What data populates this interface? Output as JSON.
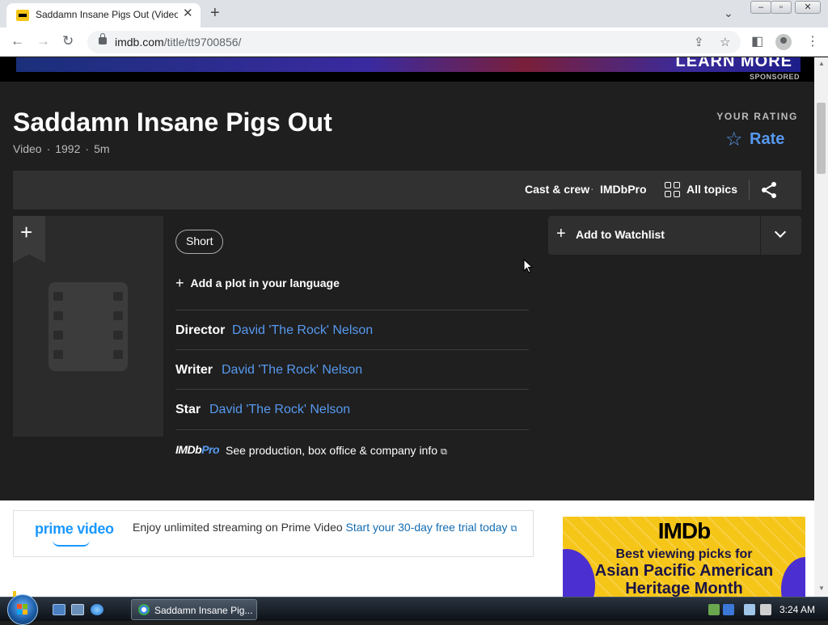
{
  "browser": {
    "tab_title": "Saddamn Insane Pigs Out (Video",
    "tab_close": "✕",
    "new_tab": "+",
    "tab_list": "⌄",
    "url_host": "imdb.com",
    "url_path": "/title/tt9700856/",
    "window_controls": [
      "–",
      "▫",
      "✕"
    ]
  },
  "ad_banner": {
    "cta": "LEARN MORE",
    "sponsored": "SPONSORED"
  },
  "title": {
    "name": "Saddamn Insane Pigs Out",
    "type": "Video",
    "year": "1992",
    "runtime": "5m",
    "separator": "·"
  },
  "rating": {
    "label": "YOUR RATING",
    "rate_label": "Rate",
    "star": "☆"
  },
  "subnav": {
    "cast_crew": "Cast & crew",
    "separator": "·",
    "imdbpro": "IMDbPro",
    "all_topics": "All topics"
  },
  "poster": {
    "add_symbol": "+"
  },
  "genres": [
    "Short"
  ],
  "plot": {
    "add_label": "Add a plot in your language",
    "plus": "+"
  },
  "credits": [
    {
      "role": "Director",
      "person": "David 'The Rock' Nelson"
    },
    {
      "role": "Writer",
      "person": "David 'The Rock' Nelson"
    },
    {
      "role": "Star",
      "person": "David 'The Rock' Nelson"
    }
  ],
  "imdbpro_row": {
    "logo_imdb": "IMDb",
    "logo_pro": "Pro",
    "text": "See production, box office & company info",
    "external_icon": "⧉"
  },
  "watchlist": {
    "plus": "+",
    "label": "Add to Watchlist"
  },
  "prime": {
    "logo": "prime video",
    "message": "Enjoy unlimited streaming on Prime Video",
    "trial_link": "Start your 30-day free trial today",
    "external_icon": "⧉"
  },
  "imdb_ad": {
    "brand": "IMDb",
    "line1": "Best viewing picks for",
    "line2": "Asian Pacific American",
    "line3": "Heritage Month"
  },
  "taskbar": {
    "task_label": "Saddamn Insane Pig...",
    "clock": "3:24 AM"
  },
  "colors": {
    "accent_blue": "#5799ef",
    "imdb_yellow": "#f5c518",
    "page_bg": "#1f1f1f"
  }
}
